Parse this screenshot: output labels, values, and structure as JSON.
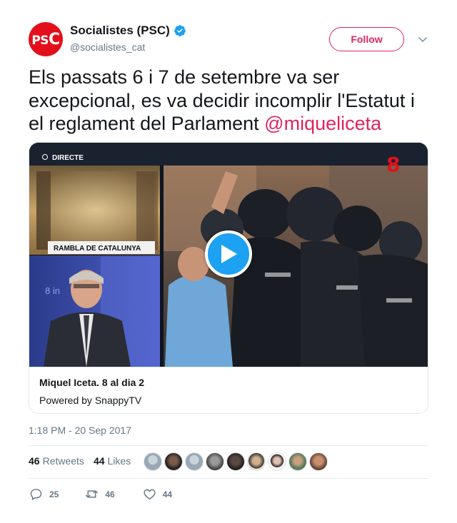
{
  "user": {
    "display_name": "Socialistes (PSC)",
    "handle": "@socialistes_cat",
    "avatar_logo": "PSC",
    "verified": true
  },
  "follow_label": "Follow",
  "tweet": {
    "text": "Els passats 6 i 7 de setembre va ser excepcional, es va decidir incomplir l'Estatut i el reglament del Parlament ",
    "mention": "@miqueliceta"
  },
  "media": {
    "live_badge": "DIRECTE",
    "location_banner": "RAMBLA DE CATALUNYA",
    "channel_logo": "8",
    "studio_text": "8 in"
  },
  "card": {
    "title": "Miquel Iceta. 8 al dia 2",
    "subtitle": "Powered by SnappyTV"
  },
  "timestamp": "1:18 PM - 20 Sep 2017",
  "stats": {
    "retweets_count": "46",
    "retweets_label": "Retweets",
    "likes_count": "44",
    "likes_label": "Likes"
  },
  "actions": {
    "replies": "25",
    "retweets": "46",
    "likes": "44"
  },
  "colors": {
    "accent": "#e0245e",
    "brand_red": "#e3101b",
    "verified_blue": "#1da1f2",
    "muted": "#657786"
  }
}
